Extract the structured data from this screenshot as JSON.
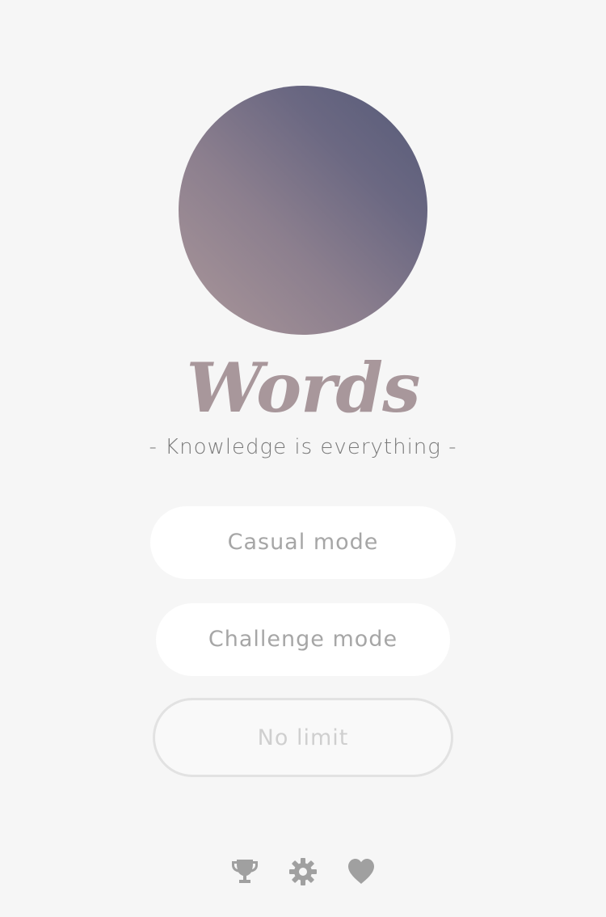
{
  "app": {
    "title": "Words",
    "subtitle": "- Knowledge is everything -"
  },
  "menu": {
    "casual_label": "Casual mode",
    "challenge_label": "Challenge mode",
    "nolimit_label": "No limit"
  },
  "footer": {
    "icons": [
      "trophy-icon",
      "gear-icon",
      "heart-icon"
    ]
  },
  "colors": {
    "background": "#f6f6f6",
    "title": "#a8979b",
    "gradient_start": "#ab979a",
    "gradient_end": "#555a78",
    "icon": "#a0a0a0"
  }
}
